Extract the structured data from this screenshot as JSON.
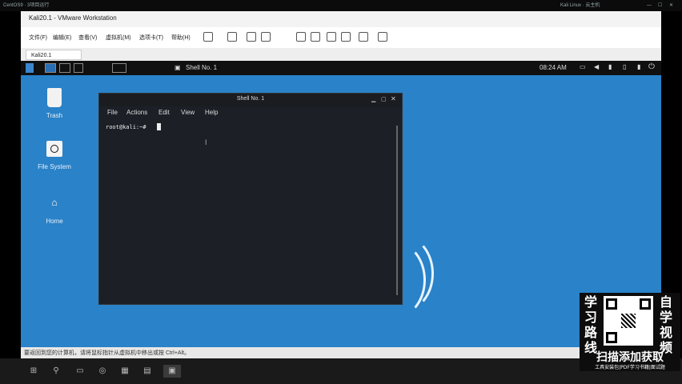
{
  "host": {
    "left_title": "CentOS9 · 3项目运行",
    "right_title": "Kali Linux · 云主机",
    "controls": [
      "—",
      "☐",
      "✕"
    ]
  },
  "vmware": {
    "title": "Kali20.1 - VMware Workstation",
    "menu": [
      "文件(F)",
      "编辑(E)",
      "查看(V)",
      "虚拟机(M)",
      "选项卡(T)",
      "帮助(H)"
    ],
    "tab": "Kali20.1"
  },
  "guest": {
    "panel": {
      "terminal_label": "Shell No. 1",
      "clock": "08:24 AM"
    },
    "desktop_icons": [
      {
        "label": "Trash",
        "icon": "trash-icon"
      },
      {
        "label": "File System",
        "icon": "filesystem-icon"
      },
      {
        "label": "Home",
        "icon": "home-icon"
      }
    ],
    "terminal": {
      "title": "Shell No. 1",
      "menu": [
        "File",
        "Actions",
        "Edit",
        "View",
        "Help"
      ],
      "prompt": "root@kali:~#"
    }
  },
  "status": {
    "text": "要返回到您的计算机，请将鼠标指针从虚拟机中移出或按 Ctrl+Alt。"
  },
  "overlay": {
    "left_chars": [
      "学",
      "习",
      "路",
      "线"
    ],
    "right_chars": [
      "自",
      "学",
      "视",
      "频"
    ],
    "headline": "扫描添加获取",
    "tags": "工具安装包|PDF学习书籍|面试题"
  },
  "colors": {
    "desktop": "#2a82c8",
    "terminal_bg": "#1c1f26",
    "panel": "#101010"
  }
}
